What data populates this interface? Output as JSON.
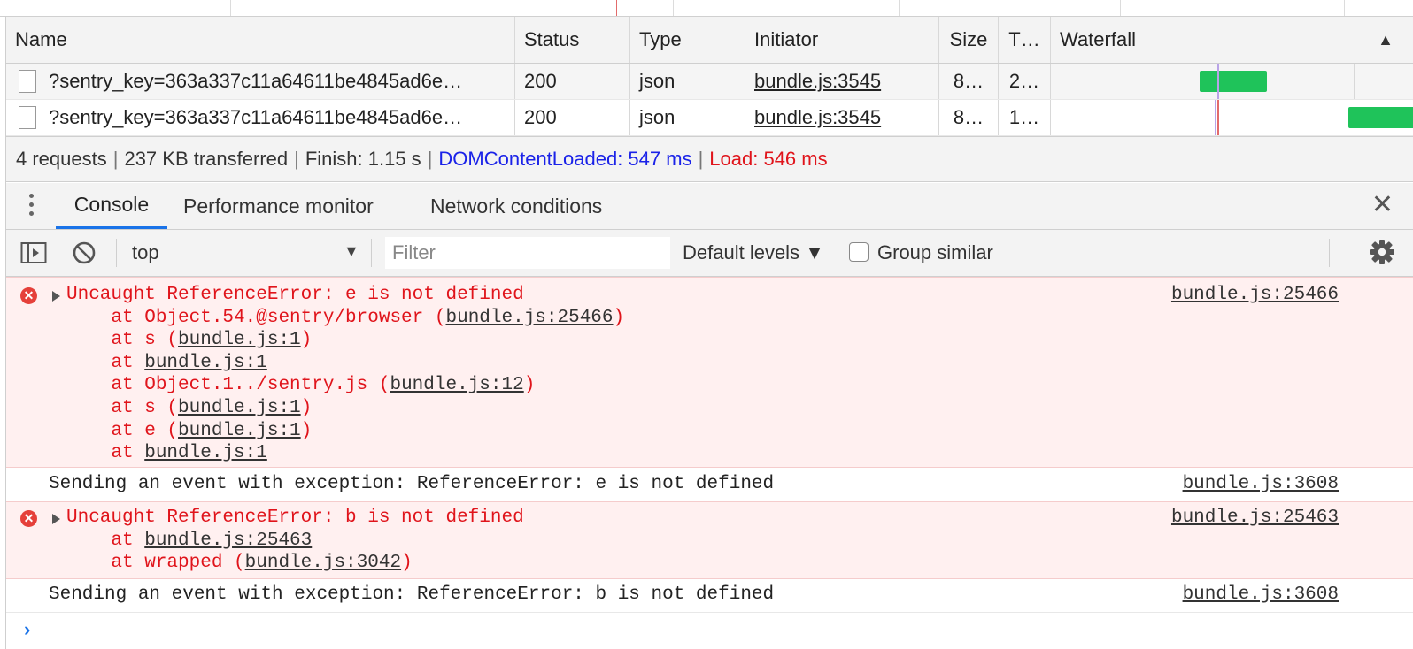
{
  "network": {
    "columns": {
      "name": "Name",
      "status": "Status",
      "type": "Type",
      "initiator": "Initiator",
      "size": "Size",
      "time": "T…",
      "waterfall": "Waterfall"
    },
    "sort_icon": "▲",
    "rows": [
      {
        "name": "?sentry_key=363a337c11a64611be4845ad6e…",
        "status": "200",
        "type": "json",
        "initiator": "bundle.js:3545",
        "size": "8…",
        "time": "2…"
      },
      {
        "name": "?sentry_key=363a337c11a64611be4845ad6e…",
        "status": "200",
        "type": "json",
        "initiator": "bundle.js:3545",
        "size": "8…",
        "time": "1…"
      }
    ],
    "summary": {
      "requests": "4 requests",
      "transferred": "237 KB transferred",
      "finish": "Finish: 1.15 s",
      "dom": "DOMContentLoaded: 547 ms",
      "load": "Load: 546 ms",
      "separator": "|"
    }
  },
  "drawer": {
    "tabs": [
      "Console",
      "Performance monitor",
      "Network conditions"
    ],
    "active_tab": "Console",
    "close": "✕"
  },
  "console_toolbar": {
    "context": "top",
    "context_arrow": "▼",
    "filter_placeholder": "Filter",
    "levels": "Default levels ▼",
    "group_similar": "Group similar"
  },
  "messages": {
    "err1": {
      "title": "Uncaught ReferenceError: e is not defined",
      "source": "bundle.js:25466",
      "stack": [
        {
          "pre": "    at Object.54.@sentry/browser (",
          "link": "bundle.js:25466",
          "post": ")"
        },
        {
          "pre": "    at s (",
          "link": "bundle.js:1",
          "post": ")"
        },
        {
          "pre": "    at ",
          "link": "bundle.js:1",
          "post": ""
        },
        {
          "pre": "    at Object.1../sentry.js (",
          "link": "bundle.js:12",
          "post": ")"
        },
        {
          "pre": "    at s (",
          "link": "bundle.js:1",
          "post": ")"
        },
        {
          "pre": "    at e (",
          "link": "bundle.js:1",
          "post": ")"
        },
        {
          "pre": "    at ",
          "link": "bundle.js:1",
          "post": ""
        }
      ]
    },
    "log1": {
      "text": "Sending an event with exception: ReferenceError: e is not defined",
      "source": "bundle.js:3608"
    },
    "err2": {
      "title": "Uncaught ReferenceError: b is not defined",
      "source": "bundle.js:25463",
      "stack": [
        {
          "pre": "    at ",
          "link": "bundle.js:25463",
          "post": ""
        },
        {
          "pre": "    at wrapped (",
          "link": "bundle.js:3042",
          "post": ")"
        }
      ]
    },
    "log2": {
      "text": "Sending an event with exception: ReferenceError: b is not defined",
      "source": "bundle.js:3608"
    },
    "prompt": "›",
    "error_badge": "✕"
  },
  "colors": {
    "error_text": "#e0141b",
    "error_bg": "#fff0f0",
    "dom_content_loaded": "#1a22e8",
    "load": "#e0141b",
    "waterfall_bar": "#1fc35a",
    "tab_accent": "#1a73e8"
  }
}
